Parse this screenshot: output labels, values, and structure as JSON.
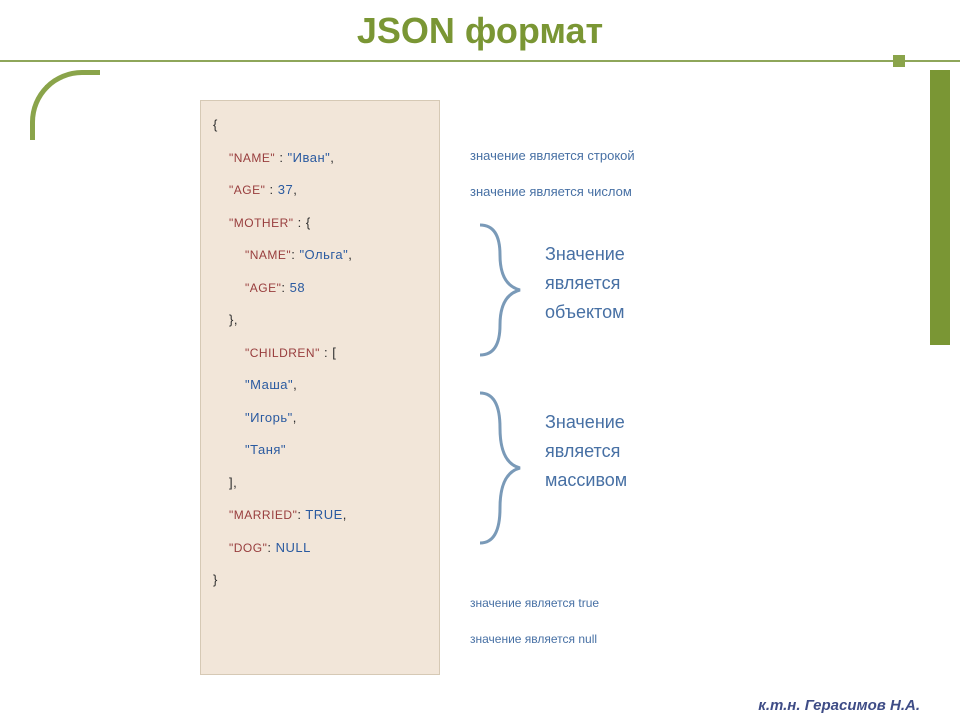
{
  "title": "JSON формат",
  "footer": "к.т.н. Герасимов Н.А.",
  "code": {
    "open": "{",
    "close": "}",
    "colon": " : ",
    "comma": ",",
    "obj_open": "{",
    "obj_close": "}",
    "arr_open": "[",
    "arr_close": "]",
    "keys": {
      "name": "\"Name\"",
      "age": "\"Age\"",
      "mother": "\"Mother\"",
      "children": "\"Children\"",
      "married": "\"Married\"",
      "dog": "\"Dog\""
    },
    "vals": {
      "name": "\"Иван\"",
      "age": "37",
      "mother_name": "\"Ольга\"",
      "mother_age": "58",
      "c1": "\"Маша\"",
      "c2": "\"Игорь\"",
      "c3": "\"Таня\"",
      "married": "TRUE",
      "dog": "NULL"
    }
  },
  "annot": {
    "string_label": "значение является строкой",
    "number_label": "значение является числом",
    "object_l1": "Значение",
    "object_l2": "является",
    "object_l3": "объектом",
    "array_l1": "Значение",
    "array_l2": "является",
    "array_l3": "массивом",
    "true_label": "значение является true",
    "null_label": "значение является null"
  }
}
